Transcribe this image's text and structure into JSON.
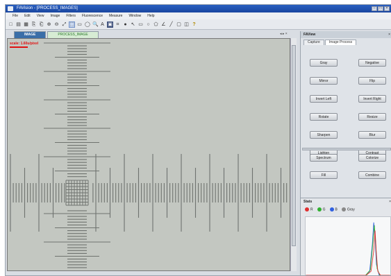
{
  "window": {
    "title": "FAVision - [PROCESS_IMAGES]"
  },
  "menu": [
    "File",
    "Edit",
    "View",
    "Image",
    "Filters",
    "Fluorescence",
    "Measure",
    "Window",
    "Help"
  ],
  "toolbar": {
    "icons": [
      "new-icon",
      "open-icon",
      "save-icon",
      "copy-icon",
      "paste-icon",
      "zoom-in-icon",
      "zoom-out-icon",
      "zoom-fit-icon",
      "select-icon",
      "rect-icon",
      "ellipse-icon",
      "zoom-icon",
      "text-icon",
      "disk-icon",
      "crop-icon",
      "record-icon",
      "pointer-icon",
      "rectangle-tool-icon",
      "circle-tool-icon",
      "polygon-tool-icon",
      "angle-tool-icon",
      "line-tool-icon",
      "window-icon",
      "split-icon",
      "help-icon"
    ],
    "active_index": 8
  },
  "tabs": [
    {
      "label": "IMAGE",
      "active": true
    },
    {
      "label": "PROCESS_IMAGE",
      "active": false
    }
  ],
  "viewer": {
    "scale_text": "scale: 1.60u/pixel"
  },
  "right_panel": {
    "title": "FAView",
    "tabs": [
      "Capture",
      "Image Process"
    ],
    "buttons": [
      "Gray",
      "Negative",
      "Mirror",
      "Flip",
      "Invert Left",
      "Invert Right",
      "Rotate",
      "Resize",
      "Sharpen",
      "Blur",
      "Lighten",
      "Contrast"
    ],
    "buttons2": [
      "Spectrum",
      "Colorize",
      "Fill",
      "Combine"
    ]
  },
  "histogram": {
    "title": "Stats",
    "legend": [
      {
        "label": "R",
        "color": "#e03030"
      },
      {
        "label": "G",
        "color": "#30b030"
      },
      {
        "label": "B",
        "color": "#3060e0"
      },
      {
        "label": "Gray",
        "color": "#888888"
      }
    ]
  },
  "colors": {
    "titlebar": "#1a46a0",
    "active_tab": "#3b6ea8",
    "scale_text": "#e01010"
  }
}
